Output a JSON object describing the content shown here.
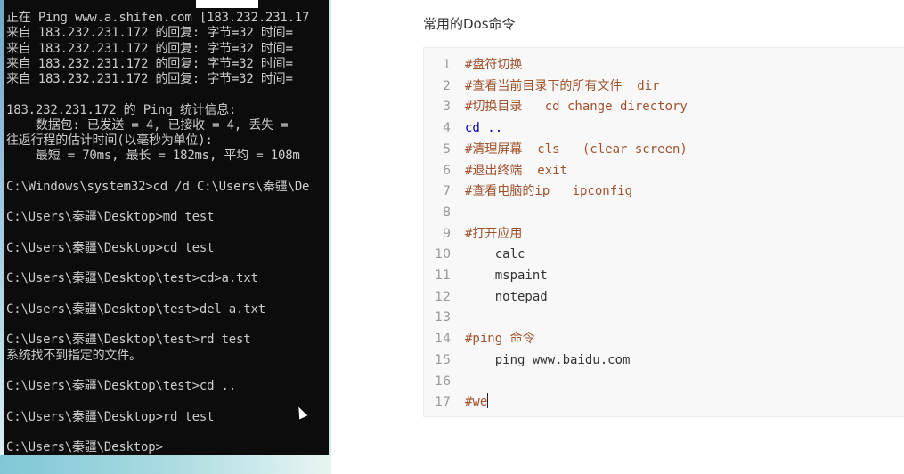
{
  "terminal": {
    "lines": [
      "正在 Ping www.a.shifen.com [183.232.231.17",
      "来自 183.232.231.172 的回复: 字节=32 时间=",
      "来自 183.232.231.172 的回复: 字节=32 时间=",
      "来自 183.232.231.172 的回复: 字节=32 时间=",
      "来自 183.232.231.172 的回复: 字节=32 时间=",
      "",
      "183.232.231.172 的 Ping 统计信息:",
      "    数据包: 已发送 = 4, 已接收 = 4, 丢失 =",
      "往返行程的估计时间(以毫秒为单位):",
      "    最短 = 70ms, 最长 = 182ms, 平均 = 108m",
      "",
      "C:\\Windows\\system32>cd /d C:\\Users\\秦疆\\De",
      "",
      "C:\\Users\\秦疆\\Desktop>md test",
      "",
      "C:\\Users\\秦疆\\Desktop>cd test",
      "",
      "C:\\Users\\秦疆\\Desktop\\test>cd>a.txt",
      "",
      "C:\\Users\\秦疆\\Desktop\\test>del a.txt",
      "",
      "C:\\Users\\秦疆\\Desktop\\test>rd test",
      "系统找不到指定的文件。",
      "",
      "C:\\Users\\秦疆\\Desktop\\test>cd ..",
      "",
      "C:\\Users\\秦疆\\Desktop>rd test",
      "",
      "C:\\Users\\秦疆\\Desktop>"
    ]
  },
  "editor": {
    "heading": "常用的Dos命令",
    "code_lines": [
      {
        "no": "1",
        "text": "#盘符切换",
        "kind": "comment"
      },
      {
        "no": "2",
        "text": "#查看当前目录下的所有文件  dir",
        "kind": "comment"
      },
      {
        "no": "3",
        "text": "#切换目录   cd change directory",
        "kind": "comment"
      },
      {
        "no": "4",
        "text": "cd ..",
        "kind": "keyword"
      },
      {
        "no": "5",
        "text": "#清理屏幕  cls   (clear screen)",
        "kind": "comment"
      },
      {
        "no": "6",
        "text": "#退出终端  exit",
        "kind": "comment"
      },
      {
        "no": "7",
        "text": "#查看电脑的ip   ipconfig",
        "kind": "comment"
      },
      {
        "no": "8",
        "text": "",
        "kind": "plain"
      },
      {
        "no": "9",
        "text": "#打开应用",
        "kind": "comment"
      },
      {
        "no": "10",
        "text": "    calc",
        "kind": "plain"
      },
      {
        "no": "11",
        "text": "    mspaint",
        "kind": "plain"
      },
      {
        "no": "12",
        "text": "    notepad",
        "kind": "plain"
      },
      {
        "no": "13",
        "text": "",
        "kind": "plain"
      },
      {
        "no": "14",
        "text": "#ping 命令",
        "kind": "comment"
      },
      {
        "no": "15",
        "text": "    ping www.baidu.com",
        "kind": "plain"
      },
      {
        "no": "16",
        "text": "",
        "kind": "plain"
      },
      {
        "no": "17",
        "text": "#we",
        "kind": "comment"
      }
    ]
  }
}
